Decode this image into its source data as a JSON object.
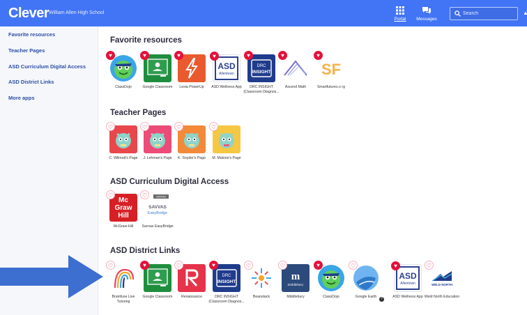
{
  "header": {
    "logo": "Clever",
    "school": "William Allen High School",
    "nav": [
      {
        "label": "Portal",
        "icon": "grid-icon"
      },
      {
        "label": "Messages",
        "icon": "chat-icon"
      }
    ],
    "search_placeholder": "Search"
  },
  "sidebar": {
    "items": [
      {
        "label": "Favorite resources"
      },
      {
        "label": "Teacher Pages"
      },
      {
        "label": "ASD Curriculum Digital Access"
      },
      {
        "label": "ASD District Links"
      },
      {
        "label": "More apps"
      }
    ]
  },
  "sections": [
    {
      "title": "Favorite resources",
      "apps": [
        {
          "name": "ClassDojo",
          "icon": "classdojo-icon",
          "favorite": true
        },
        {
          "name": "Google Classroom",
          "icon": "google-classroom-icon",
          "favorite": true
        },
        {
          "name": "Lexia PowerUp",
          "icon": "lexia-icon",
          "favorite": true
        },
        {
          "name": "ASD Wellness App",
          "icon": "asd-wellness-icon",
          "favorite": true
        },
        {
          "name": "DRC INSIGHT (Classroom Diagnos...",
          "icon": "drc-insight-icon",
          "favorite": true
        },
        {
          "name": "Ascend Math",
          "icon": "ascend-math-icon",
          "favorite": true
        },
        {
          "name": "Smartfutures.o rg",
          "icon": "smartfutures-icon",
          "favorite": true
        }
      ]
    },
    {
      "title": "Teacher Pages",
      "apps": [
        {
          "name": "C. Wilmott's Page",
          "icon": "teacher-page-icon",
          "favorite": false
        },
        {
          "name": "J. Lehman's Page",
          "icon": "teacher-page-icon",
          "favorite": false
        },
        {
          "name": "K. Snyder's Page",
          "icon": "teacher-page-icon",
          "favorite": false
        },
        {
          "name": "M. Malone's Page",
          "icon": "teacher-page-icon",
          "favorite": false
        }
      ]
    },
    {
      "title": "ASD Curriculum Digital Access",
      "apps": [
        {
          "name": "McGraw-Hill",
          "icon": "mcgraw-hill-icon",
          "favorite": false
        },
        {
          "name": "Savvas EasyBridge",
          "icon": "savvas-icon",
          "favorite": false
        }
      ]
    },
    {
      "title": "ASD District Links",
      "apps": [
        {
          "name": "Brainfuse Live Tutoring",
          "icon": "brainfuse-icon",
          "favorite": false
        },
        {
          "name": "Google Classroom",
          "icon": "google-classroom-icon",
          "favorite": true
        },
        {
          "name": "Renaissance",
          "icon": "renaissance-icon",
          "favorite": false
        },
        {
          "name": "DRC INSIGHT (Classroom Diagnos...",
          "icon": "drc-insight-icon",
          "favorite": true
        },
        {
          "name": "Beanstack",
          "icon": "beanstack-icon",
          "favorite": false
        },
        {
          "name": "Middlebury",
          "icon": "middlebury-icon",
          "favorite": false
        },
        {
          "name": "ClassDojo",
          "icon": "classdojo-icon",
          "favorite": true
        },
        {
          "name": "Google Earth",
          "icon": "google-earth-icon",
          "favorite": false
        },
        {
          "name": "ASD Wellness App",
          "icon": "asd-wellness-icon",
          "favorite": true
        },
        {
          "name": "Weld North Education",
          "icon": "weld-north-icon",
          "favorite": false
        }
      ]
    }
  ],
  "tile_text": {
    "asd": "ASD",
    "allentown": "Allentown",
    "drc": "DRC",
    "insight": "INSIGHT",
    "sf": "SF",
    "mc": "Mc",
    "graw": "Graw",
    "hill": "Hill",
    "savvas_badge": "SAVVAS",
    "savvas_l1": "SAVVAS",
    "savvas_l2": "EasyBridge",
    "middlebury": "middlebury",
    "weld": "WELD NORTH"
  },
  "colors": {
    "brand": "#4274f6",
    "heart": "#e3113a",
    "arrow": "#3d6fd1",
    "sidebar_link": "#2d4ea7"
  }
}
